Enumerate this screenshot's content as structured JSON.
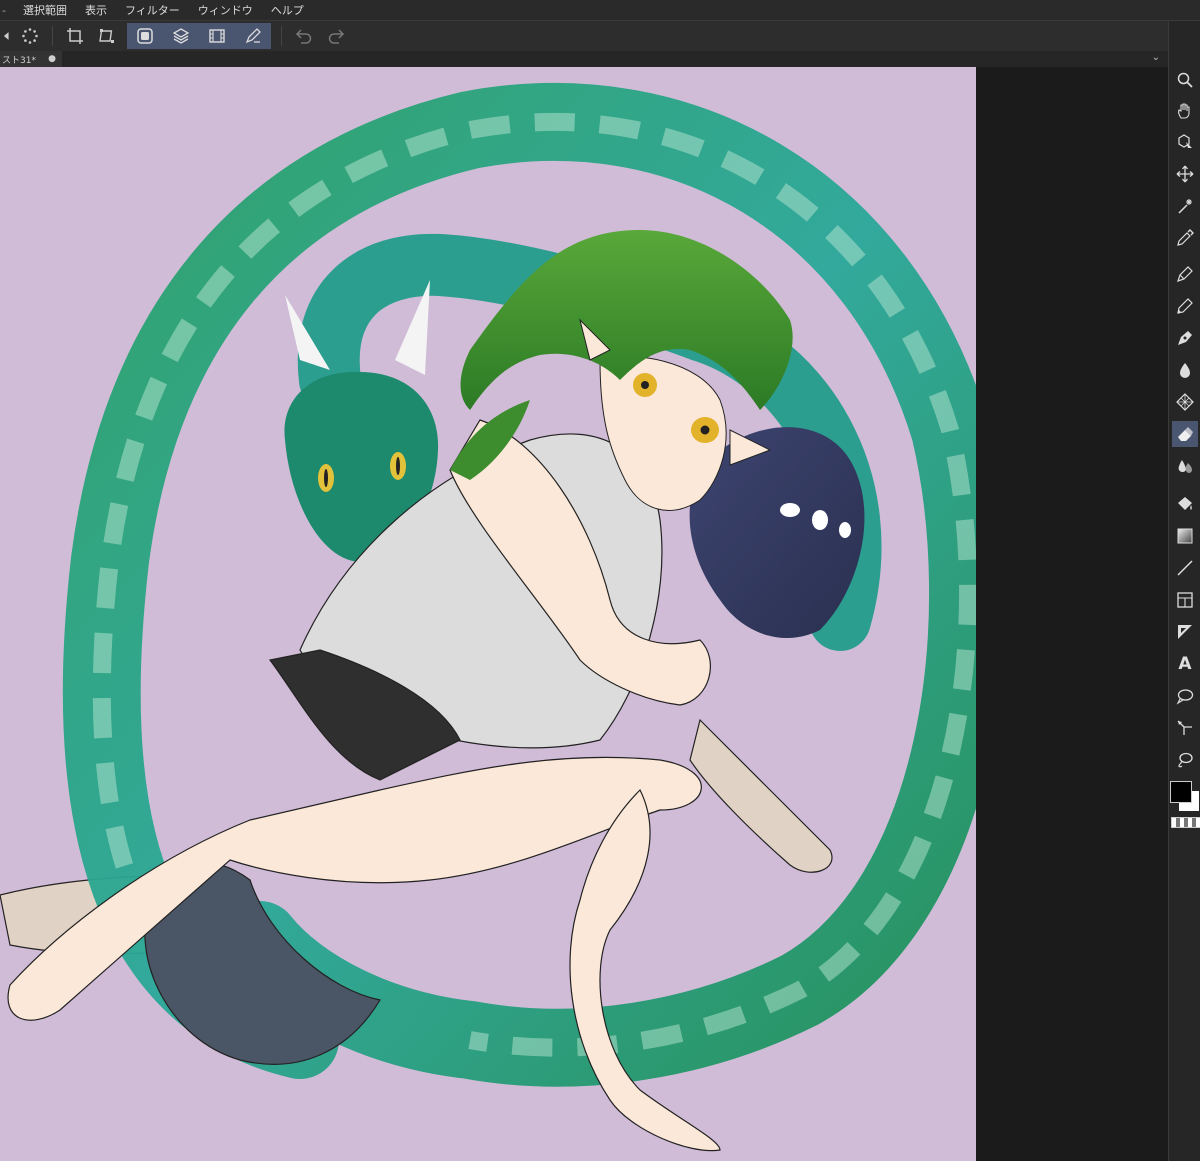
{
  "menu": {
    "edge": "-",
    "items": [
      "選択範囲",
      "表示",
      "フィルター",
      "ウィンドウ",
      "ヘルプ"
    ]
  },
  "toolbar": {
    "buttons": [
      "back-icon",
      "loading-icon",
      "crop-icon",
      "transform-icon",
      "layer-mask-icon",
      "layer-stack-icon",
      "filmstrip-icon",
      "pen-settings-icon",
      "undo-icon",
      "redo-icon"
    ]
  },
  "tab": {
    "label": "スト31*",
    "close": "●"
  },
  "tabbar": {
    "chevron": "⌄"
  },
  "rightbar": {
    "tools": [
      "zoom-icon",
      "hand-icon",
      "object-select-icon",
      "move-icon",
      "magic-wand-icon",
      "eyedropper-icon",
      "pen-icon",
      "pencil-icon",
      "ink-pen-icon",
      "brush-icon",
      "pattern-icon",
      "eraser-icon",
      "blend-icon",
      "fill-icon",
      "gradient-icon",
      "line-icon",
      "frame-icon",
      "ruler-icon",
      "text-icon",
      "balloon-icon",
      "correct-line-icon",
      "lasso-icon"
    ],
    "text_tool_label": "A",
    "active_tool": "eraser-icon",
    "main_color": "#000000",
    "sub_color": "#ffffff"
  },
  "colors": {
    "canvas_bg": "#d1bcd8",
    "ui_bg": "#1b1b1b",
    "accent": "#4a5570"
  }
}
